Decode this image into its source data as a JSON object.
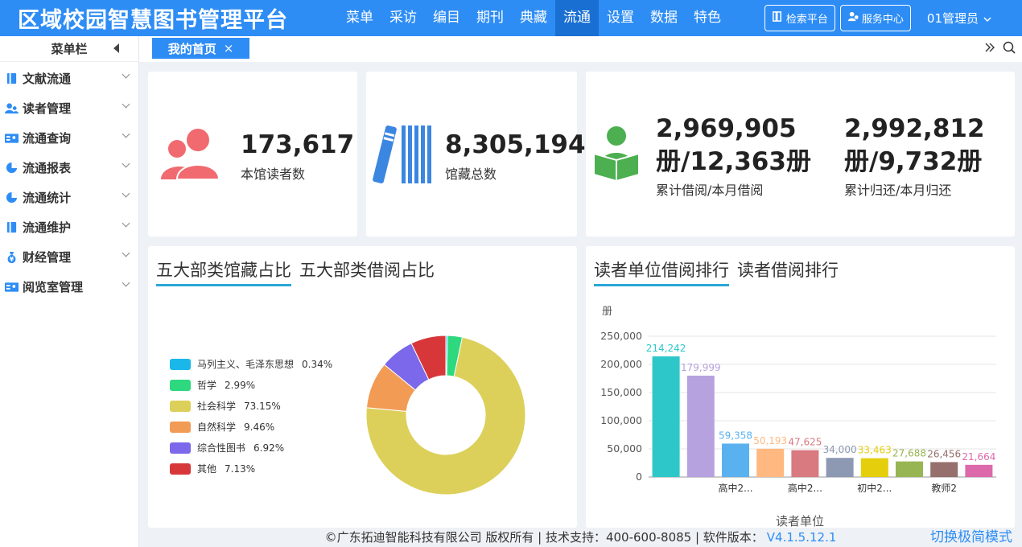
{
  "app": {
    "title": "区域校园智慧图书管理平台",
    "nav": [
      "菜单",
      "采访",
      "编目",
      "期刊",
      "典藏",
      "流通",
      "设置",
      "数据",
      "特色"
    ],
    "active_nav": "流通",
    "search_platform": "检索平台",
    "service_center": "服务中心",
    "user": "01管理员"
  },
  "sidebar": {
    "title": "菜单栏",
    "items": [
      {
        "label": "文献流通",
        "icon": "book-icon"
      },
      {
        "label": "读者管理",
        "icon": "users-icon"
      },
      {
        "label": "流通查询",
        "icon": "card-icon"
      },
      {
        "label": "流通报表",
        "icon": "pie-icon"
      },
      {
        "label": "流通统计",
        "icon": "pie-icon"
      },
      {
        "label": "流通维护",
        "icon": "book-icon"
      },
      {
        "label": "财经管理",
        "icon": "money-bag-icon"
      },
      {
        "label": "阅览室管理",
        "icon": "card-icon"
      }
    ]
  },
  "tabs": {
    "home": "我的首页",
    "close": "×"
  },
  "stats": {
    "readers": {
      "value": "173,617",
      "label": "本馆读者数"
    },
    "holdings": {
      "value": "8,305,194",
      "label": "馆藏总数"
    },
    "borrow": {
      "value_line1": "2,969,905",
      "value_line2": "册/12,363册",
      "label": "累计借阅/本月借阅"
    },
    "return": {
      "value_line1": "2,992,812",
      "value_line2": "册/9,732册",
      "label": "累计归还/本月归还"
    }
  },
  "panels": {
    "left_tab1": "五大部类馆藏占比",
    "left_tab2": "五大部类借阅占比",
    "right_tab1": "读者单位借阅排行",
    "right_tab2": "读者借阅排行"
  },
  "colors": {
    "primary": "#2e8df5",
    "nav_active": "#1a6fd3",
    "reader_icon": "#f06a6f",
    "book_icon": "#3b86e0",
    "reading_icon": "#4caf50"
  },
  "chart_data": [
    {
      "type": "pie",
      "variant": "donut",
      "categories": [
        "马列主义、毛泽东思想",
        "哲学",
        "社会科学",
        "自然科学",
        "综合性图书",
        "其他"
      ],
      "values": [
        0.34,
        2.99,
        73.15,
        9.46,
        6.92,
        7.13
      ],
      "value_labels": [
        "0.34%",
        "2.99%",
        "73.15%",
        "9.46%",
        "6.92%",
        "7.13%"
      ],
      "colors": [
        "#1ab7ea",
        "#2ed87e",
        "#dcd05a",
        "#f29b55",
        "#7b68ea",
        "#d8373a"
      ],
      "legend": "left"
    },
    {
      "type": "bar",
      "categories": [
        "",
        "",
        "高中2...",
        "",
        "高中2...",
        "",
        "初中2...",
        "",
        "教师2",
        ""
      ],
      "values": [
        214242,
        179999,
        59358,
        50193,
        47625,
        34000,
        33463,
        27688,
        26456,
        21664
      ],
      "value_labels": [
        "214,242",
        "179,999",
        "59,358",
        "50,193",
        "47,625",
        "34,000",
        "33,463",
        "27,688",
        "26,456",
        "21,664"
      ],
      "colors": [
        "#2ec7c9",
        "#b6a2de",
        "#5ab1ef",
        "#ffb980",
        "#d87a80",
        "#8d98b3",
        "#e5cf0d",
        "#97b552",
        "#95706d",
        "#dc69aa"
      ],
      "ylabel": "册",
      "xlabel": "读者单位",
      "ylim": [
        0,
        250000
      ],
      "yticks": [
        "0",
        "50,000",
        "100,000",
        "150,000",
        "200,000",
        "250,000"
      ],
      "ytick_values": [
        0,
        50000,
        100000,
        150000,
        200000,
        250000
      ],
      "grid": true
    }
  ],
  "footer": {
    "copyright": "©广东拓迪智能科技有限公司 版权所有 | 技术支持：400-600-8085 | 软件版本：",
    "version": "V4.1.5.12.1",
    "switch_mode": "切换极简模式"
  }
}
